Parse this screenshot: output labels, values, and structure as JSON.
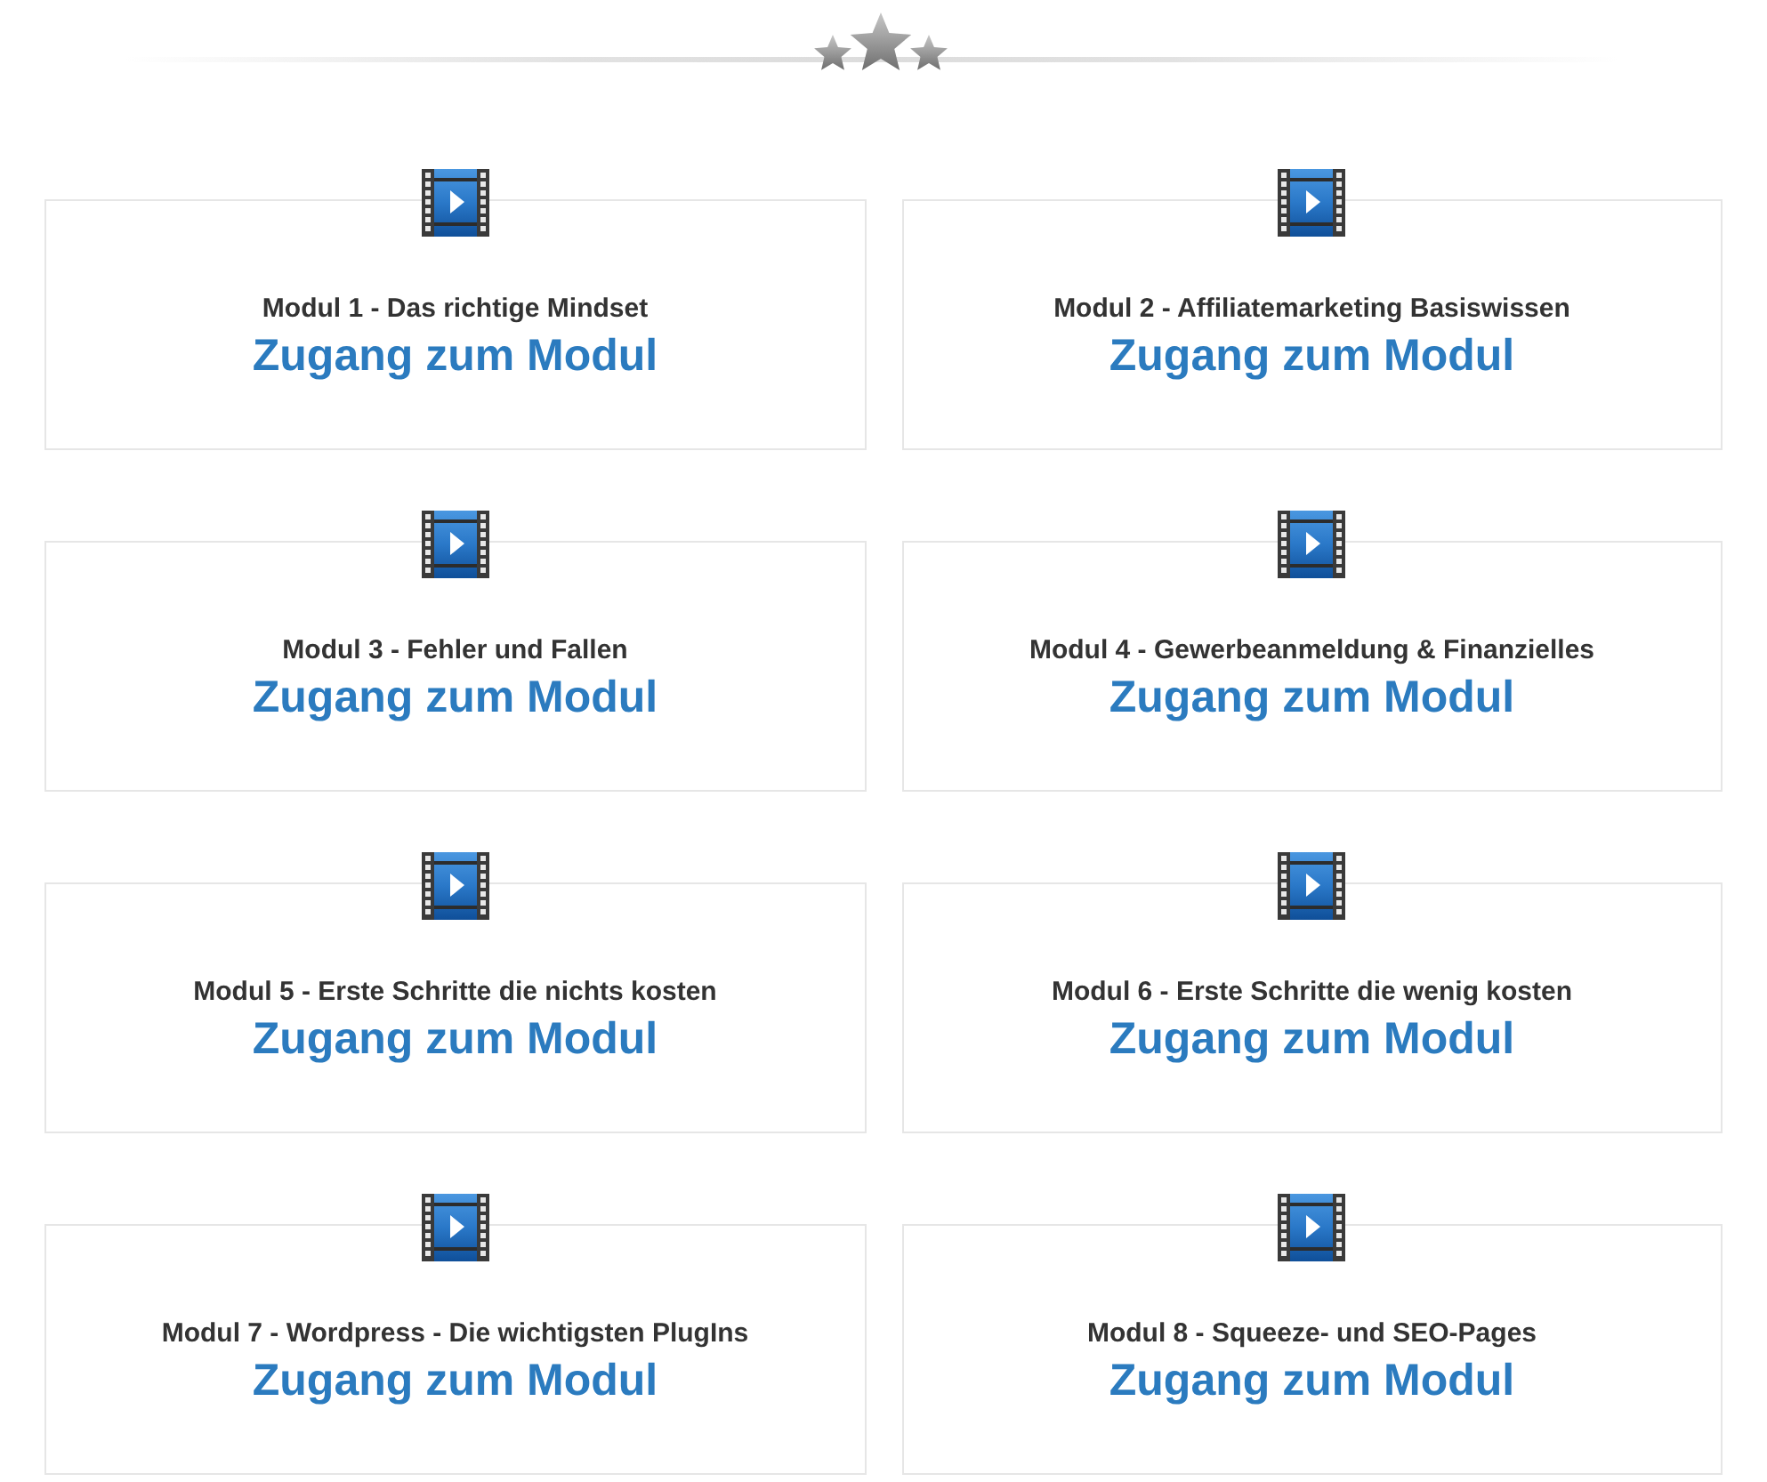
{
  "modules": [
    {
      "title": "Modul 1 - Das richtige Mindset",
      "link": "Zugang zum Modul"
    },
    {
      "title": "Modul 2 - Affiliatemarketing Basiswissen",
      "link": "Zugang zum Modul"
    },
    {
      "title": "Modul 3 - Fehler und Fallen",
      "link": "Zugang zum Modul"
    },
    {
      "title": "Modul 4 - Gewerbeanmeldung & Finanzielles",
      "link": "Zugang zum Modul"
    },
    {
      "title": "Modul 5 - Erste Schritte die nichts kosten",
      "link": "Zugang zum Modul"
    },
    {
      "title": "Modul 6 - Erste Schritte die wenig kosten",
      "link": "Zugang zum Modul"
    },
    {
      "title": "Modul 7 - Wordpress - Die wichtigsten PlugIns",
      "link": "Zugang zum Modul"
    },
    {
      "title": "Modul 8 - Squeeze- und SEO-Pages",
      "link": "Zugang zum Modul"
    }
  ]
}
